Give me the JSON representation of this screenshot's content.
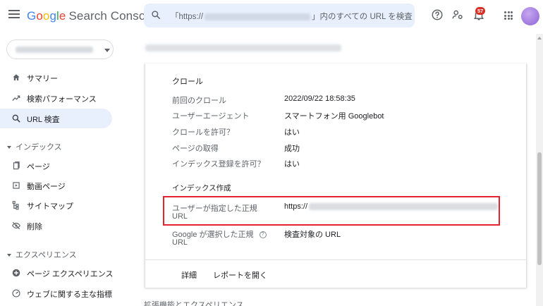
{
  "header": {
    "brand_google": [
      "G",
      "o",
      "o",
      "g",
      "l",
      "e"
    ],
    "brand_product": "Search Console",
    "search_prefix": "「https://",
    "search_suffix": "」内のすべての URL を検査",
    "notification_count": "57"
  },
  "sidebar": {
    "items_top": [
      {
        "label": "サマリー",
        "icon": "home-icon"
      },
      {
        "label": "検索パフォーマンス",
        "icon": "trending-up-icon"
      },
      {
        "label": "URL 検査",
        "icon": "search-icon",
        "active": true
      }
    ],
    "section_index": "インデックス",
    "items_index": [
      {
        "label": "ページ",
        "icon": "page-icon"
      },
      {
        "label": "動画ページ",
        "icon": "video-page-icon"
      },
      {
        "label": "サイトマップ",
        "icon": "sitemap-icon"
      },
      {
        "label": "削除",
        "icon": "remove-icon"
      }
    ],
    "section_experience": "エクスペリエンス",
    "items_experience": [
      {
        "label": "ページ エクスペリエンス",
        "icon": "plus-circle-icon"
      },
      {
        "label": "ウェブに関する主な指標",
        "icon": "gauge-icon"
      }
    ]
  },
  "card": {
    "crawl_title": "クロール",
    "crawl_rows": [
      {
        "key": "前回のクロール",
        "value": "2022/09/22 18:58:35"
      },
      {
        "key": "ユーザーエージェント",
        "value": "スマートフォン用 Googlebot"
      },
      {
        "key": "クロールを許可？",
        "value": "はい"
      },
      {
        "key": "ページの取得",
        "value": "成功"
      },
      {
        "key": "インデックス登録を許可？",
        "value": "はい"
      }
    ],
    "index_title": "インデックス作成",
    "user_canonical_key_1": "ユーザーが指定した正規",
    "user_canonical_key_2": "URL",
    "user_canonical_value": "https://",
    "google_canonical_key_1": "Google が選択した正規",
    "google_canonical_key_2": "URL",
    "google_canonical_value": "検査対象の URL",
    "help_glyph": "?",
    "footer_details": "詳細",
    "footer_report": "レポートを開く"
  },
  "bottom_section": "拡張機能とエクスペリエンス",
  "colors": {
    "accent": "#1a73e8",
    "active_bg": "#e8f0fe",
    "highlight_border": "#e3232e",
    "badge": "#d93025"
  }
}
